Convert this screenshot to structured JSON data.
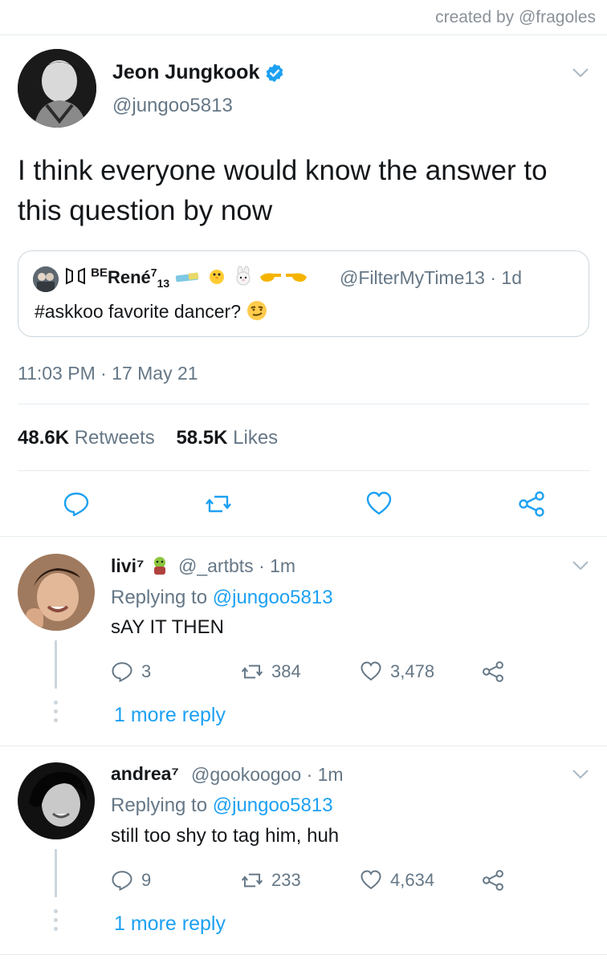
{
  "credit": "created by @fragoles",
  "tweet": {
    "author_name": "Jeon Jungkook",
    "author_handle": "@jungoo5813",
    "text": "I think everyone would know the answer to this question by now",
    "timestamp": "11:03 PM · 17 May 21",
    "retweets_count": "48.6K",
    "retweets_label": "Retweets",
    "likes_count": "58.5K",
    "likes_label": "Likes"
  },
  "quote": {
    "name_prefix": "BE",
    "name": "René",
    "name_sup": "7",
    "name_sub": "13",
    "handle": "@FilterMyTime13",
    "time": "· 1d",
    "text": "#askkoo favorite dancer?"
  },
  "replies": [
    {
      "name": "livi⁷",
      "handle": "@_artbts",
      "time": "· 1m",
      "replying_label": "Replying to",
      "replying_handle": "@jungoo5813",
      "text": "sAY IT THEN",
      "reply_count": "3",
      "retweet_count": "384",
      "like_count": "3,478",
      "more_label": "1 more reply"
    },
    {
      "name": "andrea⁷",
      "handle": "@gookoogoo",
      "time": "· 1m",
      "replying_label": "Replying to",
      "replying_handle": "@jungoo5813",
      "text": "still too shy to tag him, huh",
      "reply_count": "9",
      "retweet_count": "233",
      "like_count": "4,634",
      "more_label": "1 more reply"
    }
  ],
  "colors": {
    "accent": "#1da1f2",
    "muted": "#657786",
    "text": "#14171a",
    "divider": "#e6ecf0"
  },
  "icons": [
    "verified-icon",
    "chevron-down-icon",
    "reply-icon",
    "retweet-icon",
    "heart-icon",
    "share-icon"
  ]
}
